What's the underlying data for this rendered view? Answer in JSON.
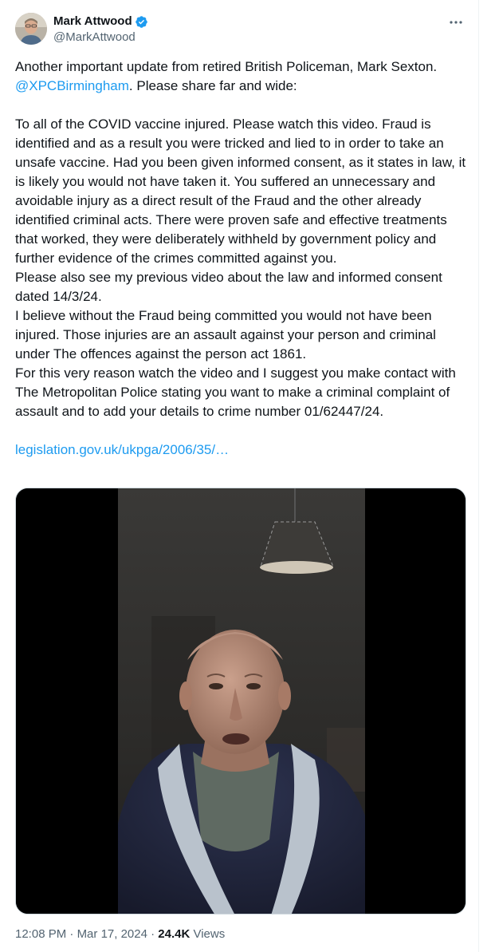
{
  "author": {
    "display_name": "Mark Attwood",
    "handle": "@MarkAttwood",
    "verified_color": "#1d9bf0"
  },
  "tweet": {
    "line_1_text": "Another important update from retired British Policeman, Mark Sexton.",
    "mention": "@XPCBirmingham",
    "line_2_text": ". Please share far and wide:",
    "paragraphs": [
      "To all of the COVID vaccine injured. Please watch this video. Fraud is identified and as a result you were tricked and lied to in order to take an unsafe vaccine. Had you been given informed consent, as it states in law, it is likely you would not have taken it. You suffered an unnecessary and avoidable injury as a direct result of the Fraud and the other already identified criminal acts. There were proven safe and effective treatments that worked, they were deliberately withheld by government policy and further evidence of the crimes committed against you.",
      "Please also see my previous video about the law and informed consent dated 14/3/24.",
      "I believe without the Fraud being committed you would not have been injured. Those injuries are an assault against your person and criminal under The offences against the person act 1861.",
      "For this very reason watch the video and I suggest you make contact with The Metropolitan Police stating you want to make a criminal complaint of assault and to add your details to crime number 01/62447/24."
    ],
    "link_text": "legislation.gov.uk/ukpga/2006/35/…"
  },
  "meta": {
    "time": "12:08 PM",
    "separator": " · ",
    "date": "Mar 17, 2024",
    "views_count": "24.4K",
    "views_label": " Views"
  },
  "icons": {
    "more": "more-horizontal-icon",
    "verified": "verified-badge-icon"
  },
  "colors": {
    "link": "#1d9bf0",
    "secondary_text": "#536471",
    "primary_text": "#0f1419"
  }
}
